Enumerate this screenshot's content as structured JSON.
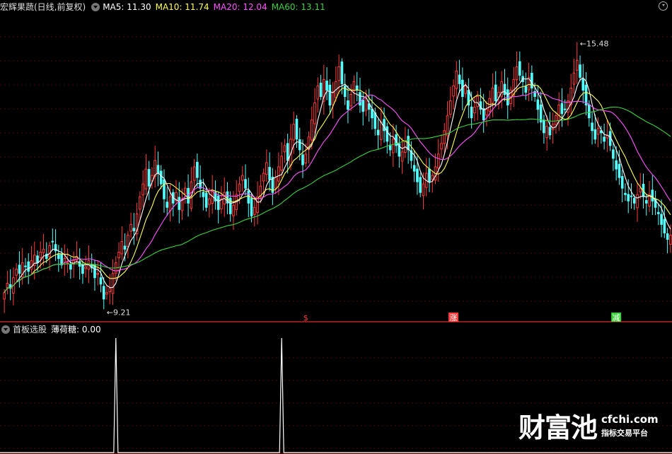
{
  "header": {
    "stock_title": "宏辉果蔬(日线,前复权)",
    "ma5": "MA5: 11.30",
    "ma10": "MA10: 11.74",
    "ma20": "MA20: 12.04",
    "ma60": "MA60: 13.11"
  },
  "sub_header": {
    "indicator_title": "首板选股",
    "indicator_value": "薄荷糖: 0.00"
  },
  "colors": {
    "up": "#ff3b3b",
    "down": "#54ffff",
    "ma5": "#ffffff",
    "ma10": "#ffff54",
    "ma20": "#ff54ff",
    "ma60": "#3cd13c",
    "grid": "#8b1a1a",
    "signal_up": "#ff3b3b",
    "signal_down": "#3cd13c"
  },
  "watermark": {
    "brand_cn": "财富池",
    "url": "cfchi.com",
    "tagline": "指标交易平台"
  },
  "chart_data": [
    {
      "type": "candlestick",
      "title": "宏辉果蔬(日线,前复权)",
      "ylim": [
        9.0,
        16.0
      ],
      "markers": [
        {
          "label": "9.21",
          "kind": "low",
          "value": 9.21,
          "bar_index": 33
        },
        {
          "label": "15.48",
          "kind": "high",
          "value": 15.48,
          "bar_index": 190
        }
      ],
      "signals": [
        {
          "label": "$",
          "bar_index": 100,
          "color": "up"
        },
        {
          "label": "涨",
          "bar_index": 149,
          "color": "up"
        },
        {
          "label": "减",
          "bar_index": 203,
          "color": "down"
        }
      ],
      "legend": [
        "MA5: 11.30",
        "MA10: 11.74",
        "MA20: 12.04",
        "MA60: 13.11"
      ],
      "close": [
        9.6,
        9.82,
        9.7,
        9.95,
        10.15,
        10.05,
        10.3,
        10.22,
        10.1,
        10.35,
        10.48,
        10.3,
        10.55,
        10.62,
        10.4,
        10.7,
        10.8,
        10.58,
        10.4,
        10.25,
        10.4,
        10.3,
        10.15,
        10.35,
        10.45,
        10.22,
        10.05,
        10.2,
        10.35,
        10.18,
        9.95,
        10.05,
        9.8,
        9.45,
        9.6,
        9.7,
        10.05,
        10.3,
        10.55,
        10.8,
        10.62,
        10.95,
        11.2,
        11.05,
        11.45,
        11.85,
        12.15,
        12.5,
        12.1,
        12.35,
        12.7,
        12.4,
        12.15,
        11.8,
        11.6,
        11.85,
        11.7,
        11.95,
        11.55,
        11.8,
        12.05,
        11.7,
        12.2,
        12.55,
        12.3,
        12.05,
        11.85,
        11.6,
        11.8,
        12.0,
        11.75,
        11.55,
        11.8,
        11.95,
        11.7,
        11.45,
        11.65,
        11.9,
        12.15,
        12.35,
        12.05,
        11.7,
        11.4,
        11.6,
        11.85,
        12.1,
        12.4,
        12.65,
        12.25,
        11.95,
        12.3,
        12.55,
        12.8,
        13.05,
        12.7,
        13.2,
        13.55,
        13.2,
        12.95,
        12.6,
        12.85,
        13.25,
        13.65,
        14.05,
        14.45,
        14.2,
        14.6,
        14.35,
        14.0,
        14.3,
        14.55,
        14.9,
        14.5,
        14.2,
        13.9,
        14.25,
        14.55,
        14.35,
        14.0,
        13.85,
        14.15,
        13.9,
        13.7,
        13.45,
        13.3,
        13.6,
        13.4,
        13.15,
        12.95,
        13.2,
        13.05,
        12.8,
        12.9,
        13.15,
        12.95,
        12.7,
        12.45,
        12.2,
        11.95,
        12.15,
        12.4,
        12.2,
        12.35,
        12.55,
        12.85,
        13.1,
        13.4,
        13.75,
        14.1,
        14.45,
        14.8,
        14.5,
        14.2,
        14.45,
        14.0,
        13.7,
        13.95,
        14.2,
        13.9,
        13.65,
        13.9,
        14.15,
        14.4,
        14.1,
        14.3,
        14.55,
        14.25,
        14.0,
        14.35,
        14.6,
        14.9,
        14.7,
        14.55,
        14.3,
        14.65,
        14.4,
        14.2,
        13.9,
        13.6,
        13.35,
        13.5,
        13.3,
        13.55,
        13.75,
        14.0,
        13.8,
        13.9,
        14.1,
        14.4,
        14.75,
        15.05,
        14.65,
        14.35,
        14.0,
        13.7,
        13.4,
        13.2,
        13.45,
        13.35,
        13.15,
        13.3,
        13.05,
        12.75,
        12.5,
        12.3,
        12.05,
        11.9,
        11.75,
        11.85,
        11.7,
        11.9,
        12.05,
        11.85,
        11.7,
        11.9,
        11.75,
        11.6,
        11.45,
        11.2,
        11.0,
        10.85,
        10.95
      ]
    },
    {
      "type": "line",
      "title": "首板选股",
      "series": [
        {
          "name": "薄荷糖",
          "spikes": [
            {
              "bar_index": 37,
              "value": 1
            },
            {
              "bar_index": 92,
              "value": 1
            }
          ]
        }
      ],
      "ylim": [
        0,
        1
      ]
    }
  ]
}
